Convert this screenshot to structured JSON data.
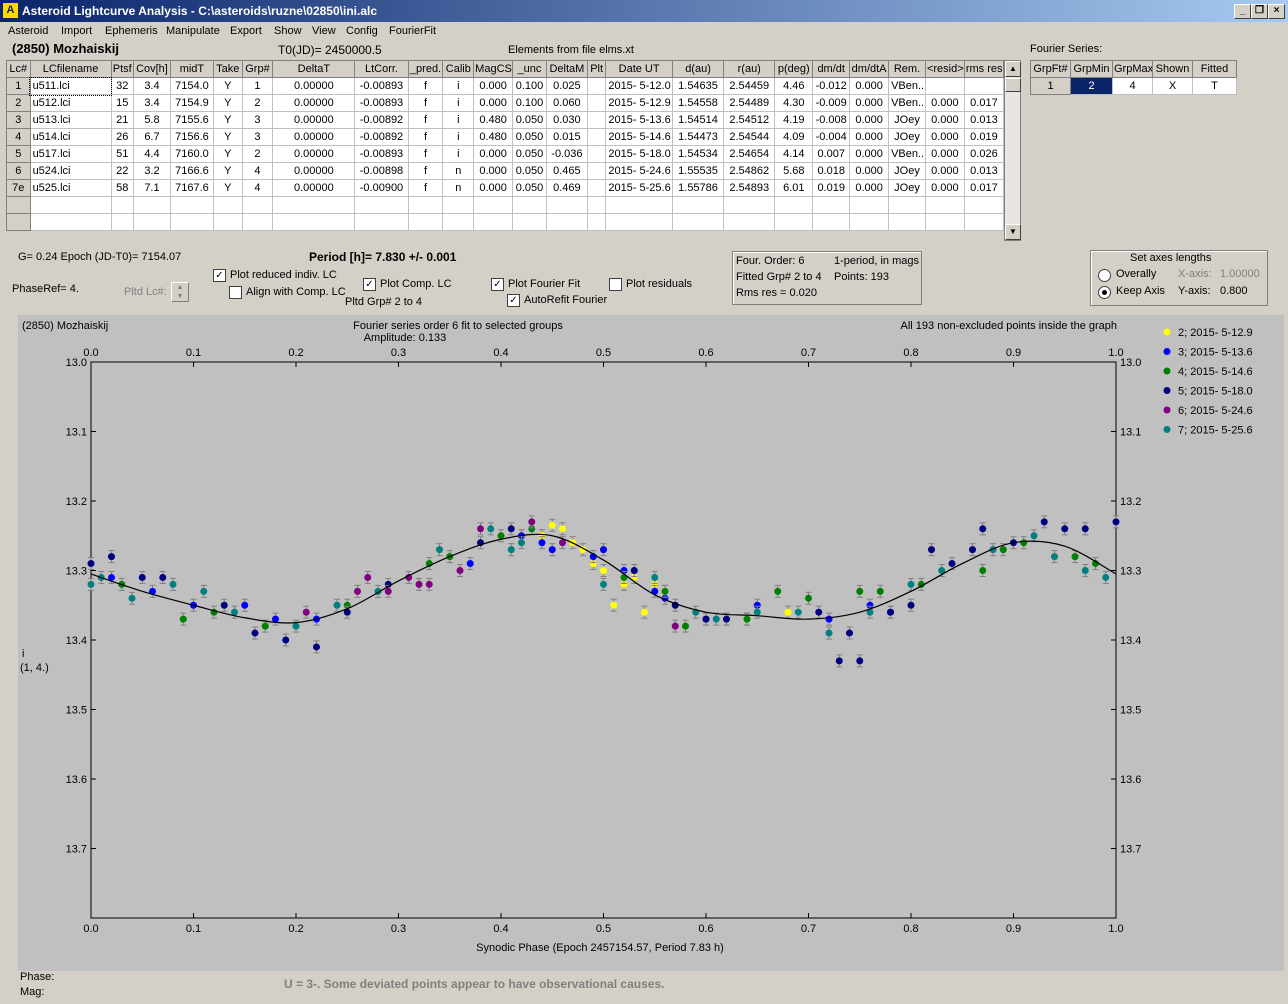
{
  "window": {
    "title": "Asteroid Lightcurve Analysis - C:\\asteroids\\ruzne\\02850\\ini.alc",
    "icon_letter": "A"
  },
  "menu": [
    "Asteroid",
    "Import",
    "Ephemeris",
    "Manipulate",
    "Export",
    "Show",
    "View",
    "Config",
    "FourierFit"
  ],
  "header": {
    "asteroid_name": "(2850) Mozhaiskij",
    "t0": "T0(JD)= 2450000.5",
    "elements": "Elements from file elms.xt",
    "fourier_label": "Fourier Series:"
  },
  "lc_table": {
    "columns": [
      "Lc#",
      "LCfilename",
      "Ptsf",
      "Cov[h]",
      "midT",
      "Take",
      "Grp#",
      "DeltaT",
      "LtCorr.",
      "_pred.",
      "Calib",
      "MagCS",
      "_unc",
      "DeltaM",
      "Plt",
      "Date UT",
      "d(au)",
      "r(au)",
      "p(deg)",
      "dm/dt",
      "dm/dtA",
      "Rem.",
      "<resid>",
      "rms res"
    ],
    "rows": [
      [
        "1",
        "u511.lci",
        "32",
        "3.4",
        "7154.0",
        "Y",
        "1",
        "0.00000",
        "-0.00893",
        "f",
        "i",
        "0.000",
        "0.100",
        "0.025",
        "",
        "2015- 5-12.0",
        "1.54635",
        "2.54459",
        "4.46",
        "-0.012",
        "0.000",
        "VBen..",
        "",
        ""
      ],
      [
        "2",
        "u512.lci",
        "15",
        "3.4",
        "7154.9",
        "Y",
        "2",
        "0.00000",
        "-0.00893",
        "f",
        "i",
        "0.000",
        "0.100",
        "0.060",
        "",
        "2015- 5-12.9",
        "1.54558",
        "2.54489",
        "4.30",
        "-0.009",
        "0.000",
        "VBen..",
        "0.000",
        "0.017"
      ],
      [
        "3",
        "u513.lci",
        "21",
        "5.8",
        "7155.6",
        "Y",
        "3",
        "0.00000",
        "-0.00892",
        "f",
        "i",
        "0.480",
        "0.050",
        "0.030",
        "",
        "2015- 5-13.6",
        "1.54514",
        "2.54512",
        "4.19",
        "-0.008",
        "0.000",
        "JOey",
        "0.000",
        "0.013"
      ],
      [
        "4",
        "u514.lci",
        "26",
        "6.7",
        "7156.6",
        "Y",
        "3",
        "0.00000",
        "-0.00892",
        "f",
        "i",
        "0.480",
        "0.050",
        "0.015",
        "",
        "2015- 5-14.6",
        "1.54473",
        "2.54544",
        "4.09",
        "-0.004",
        "0.000",
        "JOey",
        "0.000",
        "0.019"
      ],
      [
        "5",
        "u517.lci",
        "51",
        "4.4",
        "7160.0",
        "Y",
        "2",
        "0.00000",
        "-0.00893",
        "f",
        "i",
        "0.000",
        "0.050",
        "-0.036",
        "",
        "2015- 5-18.0",
        "1.54534",
        "2.54654",
        "4.14",
        "0.007",
        "0.000",
        "VBen..",
        "0.000",
        "0.026"
      ],
      [
        "6",
        "u524.lci",
        "22",
        "3.2",
        "7166.6",
        "Y",
        "4",
        "0.00000",
        "-0.00898",
        "f",
        "n",
        "0.000",
        "0.050",
        "0.465",
        "",
        "2015- 5-24.6",
        "1.55535",
        "2.54862",
        "5.68",
        "0.018",
        "0.000",
        "JOey",
        "0.000",
        "0.013"
      ],
      [
        "7e",
        "u525.lci",
        "58",
        "7.1",
        "7167.6",
        "Y",
        "4",
        "0.00000",
        "-0.00900",
        "f",
        "n",
        "0.000",
        "0.050",
        "0.469",
        "",
        "2015- 5-25.6",
        "1.55786",
        "2.54893",
        "6.01",
        "0.019",
        "0.000",
        "JOey",
        "0.000",
        "0.017"
      ]
    ]
  },
  "fourier_table": {
    "columns": [
      "GrpFt#",
      "GrpMin",
      "GrpMax",
      "Shown",
      "Fitted"
    ],
    "row": [
      "1",
      "2",
      "4",
      "X",
      "T"
    ]
  },
  "controls": {
    "g_epoch": "G= 0.24   Epoch (JD-T0)= 7154.07",
    "period": "Period [h]= 7.830 +/- 0.001",
    "phase_ref": "PhaseRef= 4.",
    "pltd_lc": "Pltd Lc#:",
    "plot_reduced": "Plot reduced indiv. LC",
    "align_comp": "Align with Comp. LC",
    "plot_comp": "Plot Comp. LC",
    "pltd_grp": "Pltd Grp#  2   to   4",
    "plot_fourier": "Plot Fourier Fit",
    "autorefit": "AutoRefit Fourier",
    "plot_residuals": "Plot residuals",
    "check_mark": "✓"
  },
  "fit_info": {
    "order": "Four. Order:  6",
    "period_type": "1-period, in mags",
    "fitted": "Fitted Grp# 2 to 4",
    "points": "Points: 193",
    "rms": "Rms res      = 0.020"
  },
  "axes_box": {
    "title": "Set axes lengths",
    "overally": "Overally",
    "keep_axis": "Keep Axis",
    "x_axis_label": "X-axis:",
    "x_axis_value": "1.00000",
    "y_axis_label": "Y-axis:",
    "y_axis_value": "0.800"
  },
  "graph": {
    "name": "(2850) Mozhaiskij",
    "title": "Fourier series order 6 fit to selected groups",
    "amplitude": "Amplitude: 0.133",
    "note": "All 193 non-excluded points inside the graph",
    "ylabel_1": "i",
    "ylabel_2": "(1, 4.)",
    "xlabel": "Synodic Phase (Epoch 2457154.57, Period 7.83 h)"
  },
  "footer": {
    "phase": "Phase:",
    "mag": "Mag:",
    "comment": "U = 3-.  Some deviated points appear to have observational causes."
  },
  "chart_data": {
    "type": "scatter",
    "title": "Fourier series order 6 fit to selected groups",
    "xlabel": "Synodic Phase (Epoch 2457154.57, Period 7.83 h)",
    "ylabel": "i (1, 4.)",
    "xlim": [
      0.0,
      1.0
    ],
    "ylim": [
      13.0,
      13.8
    ],
    "y_inverted": true,
    "x_ticks": [
      "0.0",
      "0.1",
      "0.2",
      "0.3",
      "0.4",
      "0.5",
      "0.6",
      "0.7",
      "0.8",
      "0.9",
      "1.0"
    ],
    "y_ticks": [
      "13.0",
      "13.1",
      "13.2",
      "13.3",
      "13.4",
      "13.5",
      "13.6",
      "13.7"
    ],
    "fit_curve": {
      "x": [
        0.0,
        0.05,
        0.1,
        0.15,
        0.2,
        0.25,
        0.3,
        0.35,
        0.4,
        0.45,
        0.5,
        0.55,
        0.6,
        0.65,
        0.7,
        0.75,
        0.8,
        0.85,
        0.9,
        0.95,
        1.0
      ],
      "y": [
        13.305,
        13.33,
        13.35,
        13.368,
        13.375,
        13.355,
        13.315,
        13.28,
        13.255,
        13.25,
        13.285,
        13.335,
        13.36,
        13.365,
        13.37,
        13.36,
        13.33,
        13.29,
        13.26,
        13.265,
        13.305
      ]
    },
    "series": [
      {
        "name": "2; 2015- 5-12.9",
        "color": "#ffff00",
        "points": [
          [
            0.45,
            13.235
          ],
          [
            0.46,
            13.24
          ],
          [
            0.44,
            13.25
          ],
          [
            0.48,
            13.27
          ],
          [
            0.49,
            13.29
          ],
          [
            0.5,
            13.3
          ],
          [
            0.51,
            13.35
          ],
          [
            0.52,
            13.32
          ],
          [
            0.53,
            13.31
          ],
          [
            0.54,
            13.36
          ],
          [
            0.55,
            13.32
          ],
          [
            0.56,
            13.33
          ],
          [
            0.64,
            13.37
          ],
          [
            0.68,
            13.36
          ],
          [
            0.62,
            13.37
          ],
          [
            0.47,
            13.26
          ]
        ]
      },
      {
        "name": "3; 2015- 5-13.6",
        "color": "#0000ff",
        "points": [
          [
            0.02,
            13.31
          ],
          [
            0.06,
            13.33
          ],
          [
            0.1,
            13.35
          ],
          [
            0.15,
            13.35
          ],
          [
            0.18,
            13.37
          ],
          [
            0.22,
            13.37
          ],
          [
            0.37,
            13.29
          ],
          [
            0.42,
            13.25
          ],
          [
            0.44,
            13.26
          ],
          [
            0.49,
            13.28
          ],
          [
            0.5,
            13.27
          ],
          [
            0.52,
            13.3
          ],
          [
            0.56,
            13.34
          ],
          [
            0.6,
            13.37
          ],
          [
            0.65,
            13.35
          ],
          [
            0.72,
            13.37
          ],
          [
            0.76,
            13.35
          ],
          [
            0.78,
            13.36
          ],
          [
            0.45,
            13.27
          ],
          [
            0.55,
            13.33
          ]
        ]
      },
      {
        "name": "4; 2015- 5-14.6",
        "color": "#008000",
        "points": [
          [
            0.03,
            13.32
          ],
          [
            0.09,
            13.37
          ],
          [
            0.12,
            13.36
          ],
          [
            0.17,
            13.38
          ],
          [
            0.25,
            13.35
          ],
          [
            0.33,
            13.29
          ],
          [
            0.35,
            13.28
          ],
          [
            0.4,
            13.25
          ],
          [
            0.43,
            13.24
          ],
          [
            0.52,
            13.31
          ],
          [
            0.56,
            13.33
          ],
          [
            0.58,
            13.38
          ],
          [
            0.64,
            13.37
          ],
          [
            0.67,
            13.33
          ],
          [
            0.7,
            13.34
          ],
          [
            0.75,
            13.33
          ],
          [
            0.77,
            13.33
          ],
          [
            0.81,
            13.32
          ],
          [
            0.89,
            13.27
          ],
          [
            0.91,
            13.26
          ],
          [
            0.96,
            13.28
          ],
          [
            0.98,
            13.29
          ],
          [
            0.87,
            13.3
          ]
        ]
      },
      {
        "name": "5; 2015- 5-18.0",
        "color": "#000080",
        "points": [
          [
            0.0,
            13.29
          ],
          [
            0.02,
            13.28
          ],
          [
            0.05,
            13.31
          ],
          [
            0.07,
            13.31
          ],
          [
            0.13,
            13.35
          ],
          [
            0.16,
            13.39
          ],
          [
            0.19,
            13.4
          ],
          [
            0.22,
            13.41
          ],
          [
            0.25,
            13.36
          ],
          [
            0.29,
            13.32
          ],
          [
            0.38,
            13.26
          ],
          [
            0.41,
            13.24
          ],
          [
            0.53,
            13.3
          ],
          [
            0.57,
            13.35
          ],
          [
            0.6,
            13.37
          ],
          [
            0.62,
            13.37
          ],
          [
            0.71,
            13.36
          ],
          [
            0.73,
            13.43
          ],
          [
            0.74,
            13.39
          ],
          [
            0.75,
            13.43
          ],
          [
            0.78,
            13.36
          ],
          [
            0.8,
            13.35
          ],
          [
            0.82,
            13.27
          ],
          [
            0.84,
            13.29
          ],
          [
            0.86,
            13.27
          ],
          [
            0.87,
            13.24
          ],
          [
            0.9,
            13.26
          ],
          [
            0.93,
            13.23
          ],
          [
            0.95,
            13.24
          ],
          [
            0.97,
            13.24
          ],
          [
            1.0,
            13.23
          ]
        ]
      },
      {
        "name": "6; 2015- 5-24.6",
        "color": "#800080",
        "points": [
          [
            0.21,
            13.36
          ],
          [
            0.27,
            13.31
          ],
          [
            0.29,
            13.33
          ],
          [
            0.31,
            13.31
          ],
          [
            0.32,
            13.32
          ],
          [
            0.36,
            13.3
          ],
          [
            0.38,
            13.24
          ],
          [
            0.43,
            13.23
          ],
          [
            0.46,
            13.26
          ],
          [
            0.57,
            13.38
          ],
          [
            0.26,
            13.33
          ],
          [
            0.33,
            13.32
          ]
        ]
      },
      {
        "name": "7; 2015- 5-25.6",
        "color": "#008080",
        "points": [
          [
            0.0,
            13.32
          ],
          [
            0.01,
            13.31
          ],
          [
            0.04,
            13.34
          ],
          [
            0.08,
            13.32
          ],
          [
            0.11,
            13.33
          ],
          [
            0.14,
            13.36
          ],
          [
            0.2,
            13.38
          ],
          [
            0.24,
            13.35
          ],
          [
            0.28,
            13.33
          ],
          [
            0.34,
            13.27
          ],
          [
            0.39,
            13.24
          ],
          [
            0.41,
            13.27
          ],
          [
            0.42,
            13.26
          ],
          [
            0.5,
            13.32
          ],
          [
            0.55,
            13.31
          ],
          [
            0.59,
            13.36
          ],
          [
            0.61,
            13.37
          ],
          [
            0.65,
            13.36
          ],
          [
            0.69,
            13.36
          ],
          [
            0.72,
            13.39
          ],
          [
            0.76,
            13.36
          ],
          [
            0.8,
            13.32
          ],
          [
            0.83,
            13.3
          ],
          [
            0.88,
            13.27
          ],
          [
            0.92,
            13.25
          ],
          [
            0.94,
            13.28
          ],
          [
            0.99,
            13.31
          ],
          [
            0.97,
            13.3
          ]
        ]
      }
    ]
  }
}
